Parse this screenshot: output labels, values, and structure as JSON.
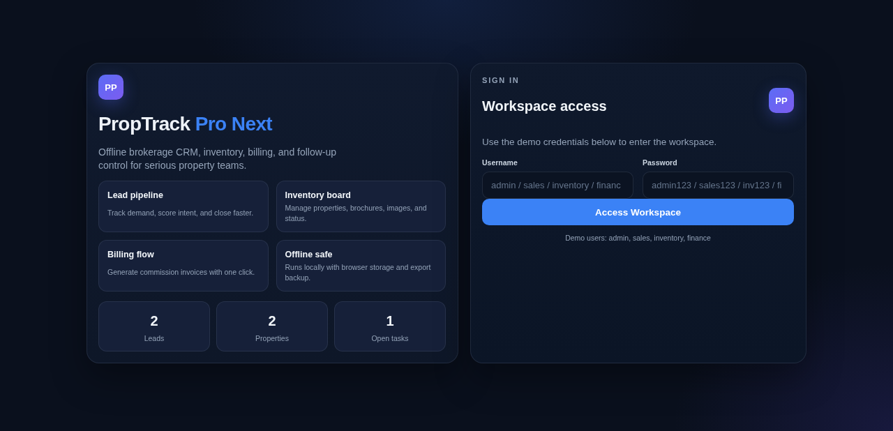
{
  "brand": {
    "logo": "PP",
    "title": "PropTrack",
    "title_accent": "Pro Next",
    "description": "Offline brokerage CRM, inventory, billing, and follow-up control for serious property teams."
  },
  "features": [
    {
      "title": "Lead pipeline",
      "description": "Track demand, score intent, and close faster."
    },
    {
      "title": "Inventory board",
      "description": "Manage properties, brochures, images, and status."
    },
    {
      "title": "Billing flow",
      "description": "Generate commission invoices with one click."
    },
    {
      "title": "Offline safe",
      "description": "Runs locally with browser storage and export backup."
    }
  ],
  "stats": [
    {
      "value": "2",
      "label": "Leads"
    },
    {
      "value": "2",
      "label": "Properties"
    },
    {
      "value": "1",
      "label": "Open tasks"
    }
  ],
  "sign_in": {
    "eyebrow": "SIGN IN",
    "title": "Workspace access",
    "logo": "PP",
    "description": "Use the demo credentials below to enter the workspace.",
    "fields": [
      {
        "label": "Username",
        "placeholder": "admin / sales / inventory / financ"
      },
      {
        "label": "Password",
        "placeholder": "admin123 / sales123 / inv123 / fi"
      }
    ],
    "button": "Access Workspace",
    "note": "Demo users: admin, sales, inventory, finance"
  }
}
